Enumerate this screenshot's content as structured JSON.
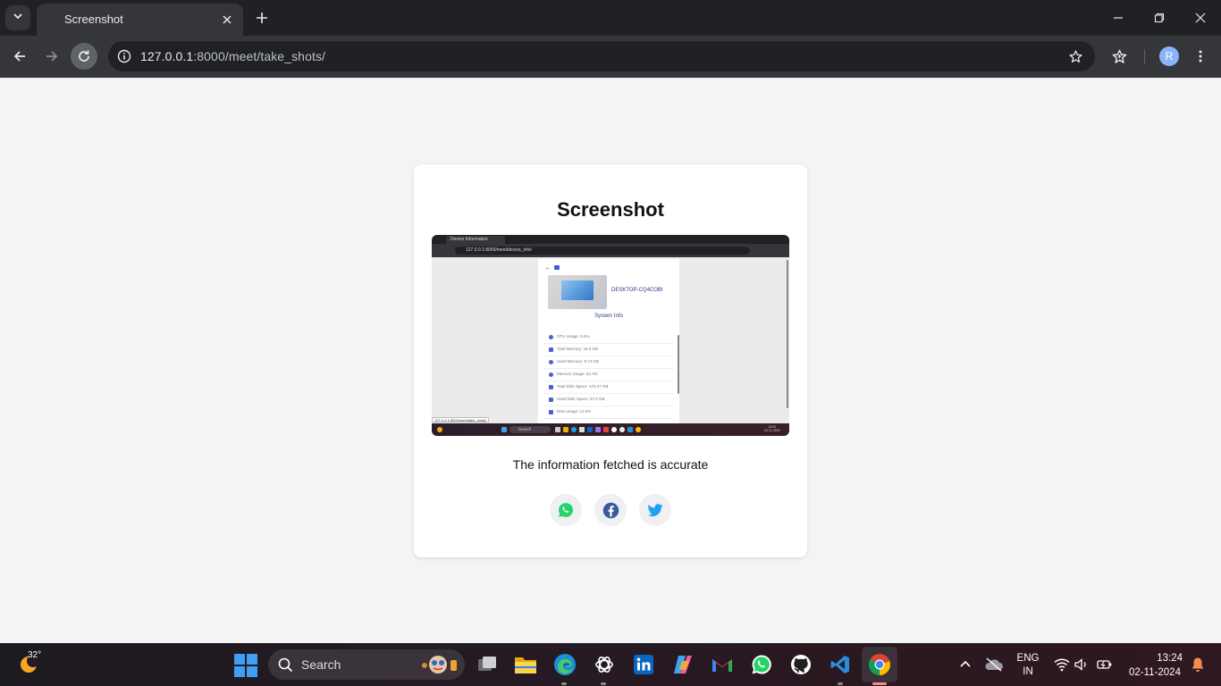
{
  "browser": {
    "tab_title": "Screenshot",
    "url_host": "127.0.0.1",
    "url_path": ":8000/meet/take_shots/",
    "profile_initial": "R"
  },
  "page": {
    "title": "Screenshot",
    "caption": "The information fetched is accurate",
    "share_buttons": [
      "whatsapp-icon",
      "facebook-icon",
      "twitter-icon"
    ],
    "colors": {
      "whatsapp": "#25d366",
      "facebook": "#3b5998",
      "twitter": "#1da1f2"
    }
  },
  "screenshot": {
    "tab_title": "Device Information",
    "url": "127.0.0.1:8000/meet/device_info/",
    "hostname": "DESKTOP-CQ4COBI",
    "section_title": "System Info",
    "rows": [
      "CPU Usage: 9.4%",
      "Total Memory: 15.6 GB",
      "Used Memory: 6.74 GB",
      "Memory Usage: 52.4%",
      "Total Disk Space: 476.37 GB",
      "Used Disk Space: 57.0 GB",
      "Disk Usage: 12.0%"
    ],
    "status_url": "127.0.0.1:8000/meet/take_shots/",
    "search_label": "Search",
    "time": "13:22",
    "date": "02-11-2024"
  },
  "taskbar": {
    "temperature": "32°",
    "search_label": "Search",
    "language": "ENG",
    "region": "IN",
    "time": "13:24",
    "date": "02-11-2024"
  }
}
